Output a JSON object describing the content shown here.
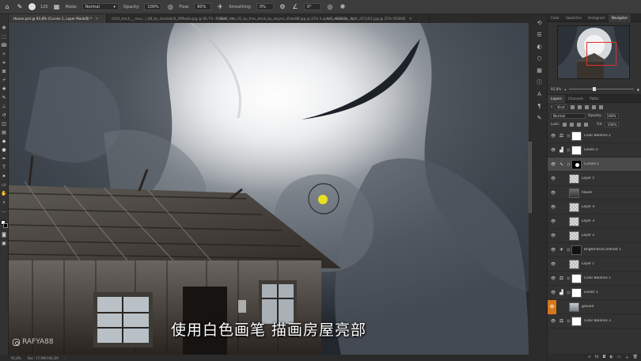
{
  "options_bar": {
    "brush_size": "125",
    "mode_label": "Mode:",
    "mode_value": "Normal",
    "opacity_label": "Opacity:",
    "opacity_value": "100%",
    "flow_label": "Flow:",
    "flow_value": "60%",
    "smoothing_label": "Smoothing:",
    "smoothing_value": "0%",
    "angle_value": "0°"
  },
  "tabs": [
    {
      "label": "House.psd @ 92,8% (Curves 1, Layer Mask/8) *",
      "active": true
    },
    {
      "label": "child_stock___mou...l_88_by_studiobrill_d9fba6a.jpg @ 66,7% (RGB/8)",
      "active": false
    },
    {
      "label": "dead_tree_01_by_free_stock_by_wayne_d5abd8f.jpg @ 25% (Layer 1, RGB/8)",
      "active": false
    },
    {
      "label": "full_moon_by_light_d17yfs1.jpg @ 25% (RGB/8)",
      "active": false
    }
  ],
  "canvas": {
    "subtitle": "使用白色画笔 描画房屋亮部",
    "watermark": "RAFYA88"
  },
  "status": {
    "zoom": "92,8%",
    "doc": "Doc: 17,9M/166,2M"
  },
  "panel_tabs": [
    {
      "label": "Color",
      "active": false
    },
    {
      "label": "Swatches",
      "active": false
    },
    {
      "label": "Histogram",
      "active": false
    },
    {
      "label": "Navigator",
      "active": true
    }
  ],
  "navigator": {
    "zoom": "92,8%"
  },
  "layers_panel": {
    "tabs": [
      {
        "label": "Layers",
        "active": true
      },
      {
        "label": "Channels",
        "active": false
      },
      {
        "label": "Paths",
        "active": false
      }
    ],
    "kind_label": "Kind",
    "blend_mode": "Normal",
    "opacity_label": "Opacity:",
    "opacity_value": "100%",
    "lock_label": "Lock:",
    "fill_label": "Fill:",
    "fill_value": "100%",
    "layers": [
      {
        "name": "Color Balance 2",
        "type": "adjustment",
        "icon": "balance",
        "thumb": "white",
        "selected": false
      },
      {
        "name": "Levels 2",
        "type": "adjustment",
        "icon": "levels",
        "thumb": "white",
        "selected": false
      },
      {
        "name": "Curves 1",
        "type": "adjustment",
        "icon": "curves",
        "thumb": "mask-b",
        "selected": true
      },
      {
        "name": "Layer 5",
        "type": "pixel",
        "icon": "",
        "thumb": "check",
        "selected": false
      },
      {
        "name": "house",
        "type": "pixel",
        "icon": "",
        "thumb": "house",
        "selected": false
      },
      {
        "name": "Layer 4",
        "type": "pixel",
        "icon": "",
        "thumb": "check",
        "selected": false
      },
      {
        "name": "Layer 3",
        "type": "pixel",
        "icon": "",
        "thumb": "check",
        "selected": false
      },
      {
        "name": "Layer 2",
        "type": "pixel",
        "icon": "",
        "thumb": "check",
        "selected": false
      },
      {
        "name": "Brightness/Contrast 1",
        "type": "adjustment",
        "icon": "brightness",
        "thumb": "black",
        "selected": false
      },
      {
        "name": "Layer 1",
        "type": "pixel",
        "icon": "",
        "thumb": "check",
        "selected": false
      },
      {
        "name": "Color Balance 1",
        "type": "adjustment",
        "icon": "balance",
        "thumb": "white",
        "selected": false
      },
      {
        "name": "Levels 1",
        "type": "adjustment",
        "icon": "levels",
        "thumb": "white",
        "selected": false
      },
      {
        "name": "ground",
        "type": "pixel",
        "icon": "",
        "thumb": "cloud",
        "selected": false
      },
      {
        "name": "Color Balance 3",
        "type": "adjustment",
        "icon": "balance",
        "thumb": "white",
        "selected": false
      }
    ]
  }
}
